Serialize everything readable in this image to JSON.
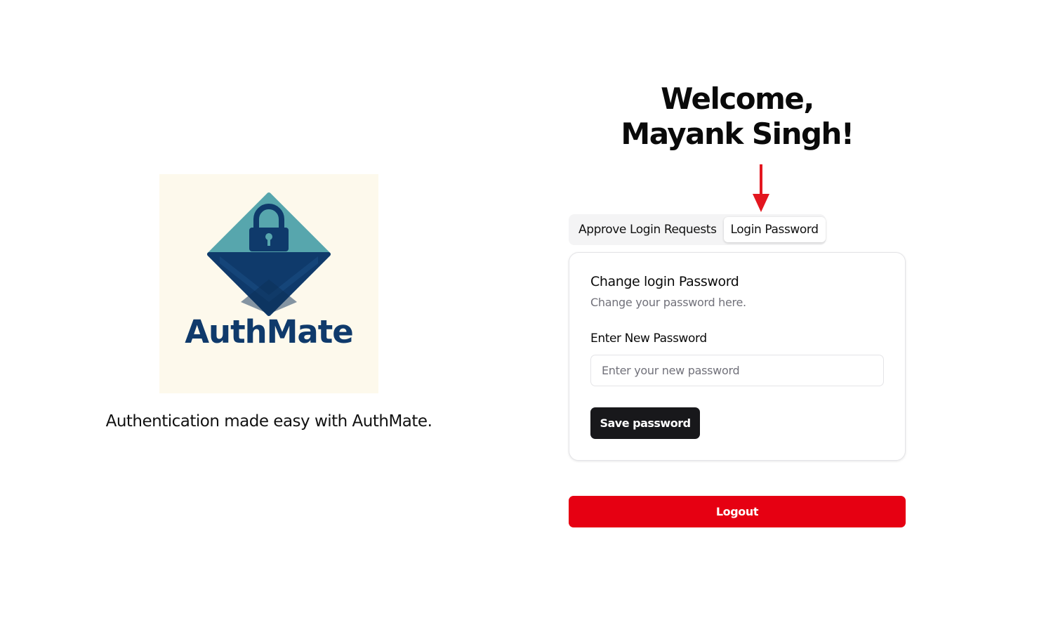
{
  "brand": {
    "logo_name": "lock-diamond-logo",
    "wordmark": "AuthMate",
    "tagline": "Authentication made easy with AuthMate.",
    "colors": {
      "logo_background": "#fdf9ec",
      "diamond_top": "#57a6ad",
      "diamond_bottom": "#0f3a6b",
      "wordmark": "#0f3a6b"
    }
  },
  "welcome": {
    "line1": "Welcome,",
    "line2": "Mayank Singh!"
  },
  "annotation": {
    "icon": "arrow-down-icon",
    "color": "#e3161f"
  },
  "tabs": [
    {
      "label": "Approve Login Requests",
      "active": false
    },
    {
      "label": "Login Password",
      "active": true
    }
  ],
  "card": {
    "title": "Change login Password",
    "description": "Change your password here.",
    "field_label": "Enter New Password",
    "input_value": "",
    "input_placeholder": "Enter your new password",
    "save_label": "Save password"
  },
  "logout": {
    "label": "Logout",
    "color": "#e60012"
  }
}
